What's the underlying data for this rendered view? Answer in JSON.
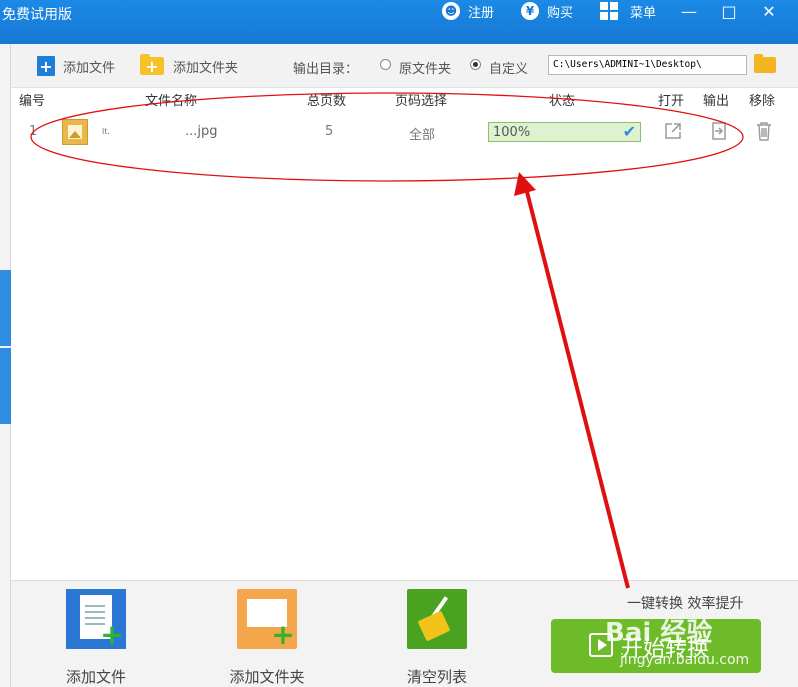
{
  "window": {
    "title": "免费试用版",
    "register_label": "注册",
    "buy_label": "购买",
    "menu_label": "菜单"
  },
  "toolbar": {
    "add_file": "添加文件",
    "add_folder": "添加文件夹",
    "output_dir_label": "输出目录：",
    "option_original": "原文件夹",
    "option_custom": "自定义",
    "selected_option": "自定义",
    "output_path": "C:\\Users\\ADMINI~1\\Desktop\\"
  },
  "table": {
    "headers": [
      "编号",
      "文件名称",
      "总页数",
      "页码选择",
      "状态",
      "打开",
      "输出",
      "移除"
    ],
    "rows": [
      {
        "index": "1",
        "name_prefix": "lt.",
        "filename": "...jpg",
        "pages": "5",
        "page_select": "全部",
        "status": "100%",
        "progress": 1.0
      }
    ]
  },
  "bottom": {
    "add_file": "添加文件",
    "add_folder": "添加文件夹",
    "clear_list": "清空列表",
    "slogan": "一键转换  效率提升",
    "start": "开始转换"
  },
  "watermark": {
    "line1": "Bai 经验",
    "line2": "jingyan.baidu.com"
  },
  "colors": {
    "titlebar": "#1678d4",
    "start_button": "#6ebb2a",
    "annotation": "#e01010",
    "progress_fill": "#dff2cf"
  }
}
